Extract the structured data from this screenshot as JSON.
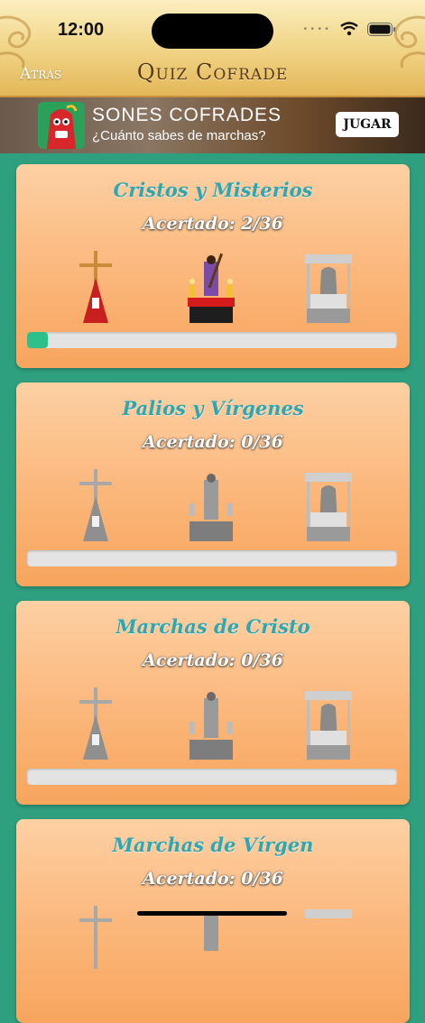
{
  "status": {
    "time": "12:00"
  },
  "nav": {
    "back_label": "Atrás",
    "title": "Quiz Cofrade"
  },
  "banner": {
    "title": "SONES COFRADES",
    "subtitle": "¿Cuánto sabes de marchas?",
    "button": "JUGAR"
  },
  "categories": [
    {
      "title": "Cristos y Misterios",
      "score": "Acertado: 2/36",
      "progress": 0.056,
      "active": true
    },
    {
      "title": "Palios y Vírgenes",
      "score": "Acertado: 0/36",
      "progress": 0,
      "active": false
    },
    {
      "title": "Marchas de Cristo",
      "score": "Acertado: 0/36",
      "progress": 0,
      "active": false
    },
    {
      "title": "Marchas de Vírgen",
      "score": "Acertado: 0/36",
      "progress": 0,
      "active": false
    }
  ],
  "colors": {
    "accent_title": "#2fa7b3",
    "progress_fill": "#2fbf8a",
    "background": "#2fa07f"
  }
}
